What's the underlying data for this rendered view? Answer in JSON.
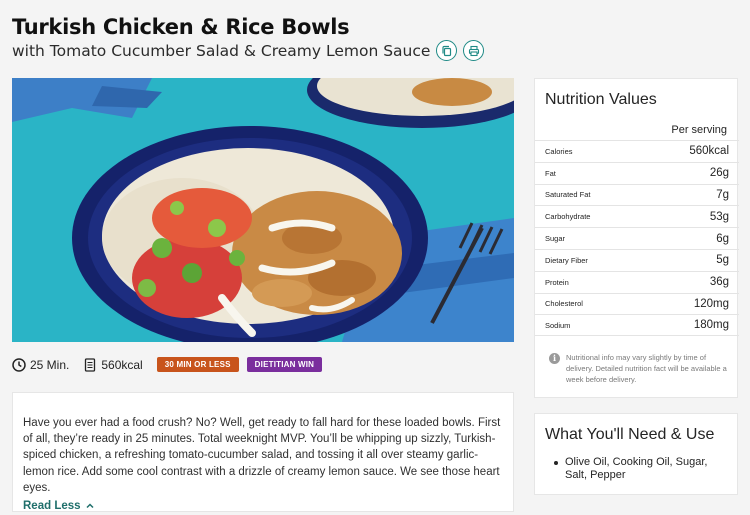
{
  "recipe": {
    "title": "Turkish Chicken & Rice Bowls",
    "subtitle": "with Tomato Cucumber Salad & Creamy Lemon Sauce"
  },
  "actions": {
    "copy_icon": "copy-icon",
    "print_icon": "print-icon"
  },
  "meta": {
    "time": "25 Min.",
    "calories": "560kcal",
    "tags": [
      "30 MIN OR LESS",
      "DIETITIAN WIN"
    ],
    "tag_colors": [
      "#c8541c",
      "#7a2e9d"
    ]
  },
  "description": {
    "text": "Have you ever had a food crush? No? Well, get ready to fall hard for these loaded bowls. First of all, they’re ready in 25 minutes. Total weeknight MVP. You’ll be whipping up sizzly, Turkish-spiced chicken, a refreshing tomato-cucumber salad, and tossing it all over steamy garlic-lemon rice. Add some cool contrast with a drizzle of creamy lemon sauce. We see those heart eyes.",
    "read_less": "Read Less"
  },
  "nutrition": {
    "title": "Nutrition Values",
    "per_serving": "Per serving",
    "rows": [
      {
        "label": "Calories",
        "value": "560kcal"
      },
      {
        "label": "Fat",
        "value": "26g"
      },
      {
        "label": "Saturated Fat",
        "value": "7g"
      },
      {
        "label": "Carbohydrate",
        "value": "53g"
      },
      {
        "label": "Sugar",
        "value": "6g"
      },
      {
        "label": "Dietary Fiber",
        "value": "5g"
      },
      {
        "label": "Protein",
        "value": "36g"
      },
      {
        "label": "Cholesterol",
        "value": "120mg"
      },
      {
        "label": "Sodium",
        "value": "180mg"
      }
    ],
    "note": "Nutritional info may vary slightly by time of delivery. Detailed nutrition fact will be available a week before delivery."
  },
  "need": {
    "title": "What You'll Need & Use",
    "items": [
      "Olive Oil, Cooking Oil, Sugar, Salt, Pepper"
    ]
  },
  "colors": {
    "accent": "#1f8a86",
    "link": "#1f6f6b",
    "bowl": "#1c2b6e",
    "background_teal": "#2ab4c6"
  }
}
